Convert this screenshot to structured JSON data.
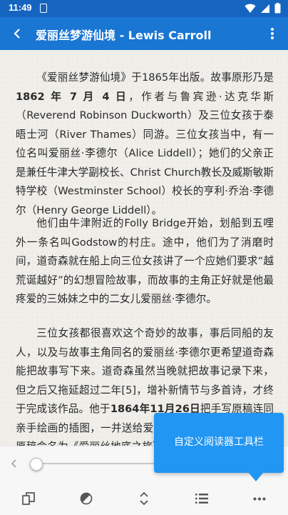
{
  "status_bar": {
    "time": "11:49"
  },
  "app_bar": {
    "title": "爱丽丝梦游仙境 - Lewis Carroll"
  },
  "content": {
    "p1": {
      "s1": "《爱丽丝梦游仙境》",
      "s2": "于1865年出版。故事原形乃是",
      "s3": "1862 年 7 月 4 日",
      "s4": "，作者与鲁宾逊·达克华斯（Reverend Robinson Duckworth）及三位女孩于泰晤士河（River Thames）同游。三位女孩当中，有一位名叫爱丽丝·李德尔（Alice Liddell）；她们的父亲正是兼任牛津大学副校长、Christ Church教长及威斯敏斯特学校（Westminster School）校长的亨利·乔治·李德尔（Henry George Liddell）。"
    },
    "p2": "他们由牛津附近的Folly Bridge开始，划船到五哩外一条名叫Godstow的村庄。途中，他们为了消磨时间，道奇森就在船上向三位女孩讲了一个应她们要求“越荒诞越好”的幻想冒险故事，而故事的主角正好就是他最疼爱的三姊妹之中的二女儿爱丽丝·李德尔。",
    "p3": {
      "s1": "三位女孩都很喜欢这个奇妙的故事，事后同船的友人，以及与故事主角同名的爱丽丝·李德尔更希望道奇森能把故事写下来。道奇森虽然当晚就把故事记录下来，但之后又拖延超过二年[5]，增补新情节与多首诗，才终于完成该作品。他于",
      "s2": "1864年11月26日",
      "s3": "把手写原稿连同亲手绘画的插图，一并送给爱丽丝·李德尔。最初，他的原稿命名为《爱丽丝地底之旅》。一些爱丽斯故事的研究者如"
    }
  },
  "progress": {
    "value": 0.02
  },
  "toolbar": {
    "items": [
      {
        "icon": "book-pages-icon"
      },
      {
        "icon": "theme-contrast-icon"
      },
      {
        "icon": "vertical-expand-icon"
      },
      {
        "icon": "list-icon"
      },
      {
        "icon": "more-horizontal-icon"
      }
    ]
  },
  "tooltip": {
    "text": "自定义阅读器工具栏"
  },
  "colors": {
    "status_bar": "#1565c0",
    "app_bar": "#1976d2",
    "tooltip": "#2196f3",
    "page_bg": "#efeee9"
  }
}
